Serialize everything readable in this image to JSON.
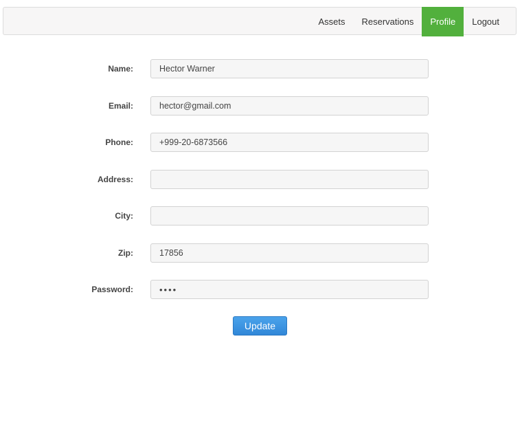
{
  "nav": {
    "items": [
      {
        "label": "Assets",
        "active": false
      },
      {
        "label": "Reservations",
        "active": false
      },
      {
        "label": "Profile",
        "active": true
      },
      {
        "label": "Logout",
        "active": false
      }
    ],
    "active_color": "#52b03d"
  },
  "form": {
    "name": {
      "label": "Name:",
      "value": "Hector Warner"
    },
    "email": {
      "label": "Email:",
      "value": "hector@gmail.com"
    },
    "phone": {
      "label": "Phone:",
      "value": "+999-20-6873566"
    },
    "address": {
      "label": "Address:",
      "value": ""
    },
    "city": {
      "label": "City:",
      "value": ""
    },
    "zip": {
      "label": "Zip:",
      "value": "17856"
    },
    "password": {
      "label": "Password:",
      "value": "abcd"
    },
    "update_label": "Update"
  },
  "colors": {
    "primary_button": "#3a8fde"
  }
}
